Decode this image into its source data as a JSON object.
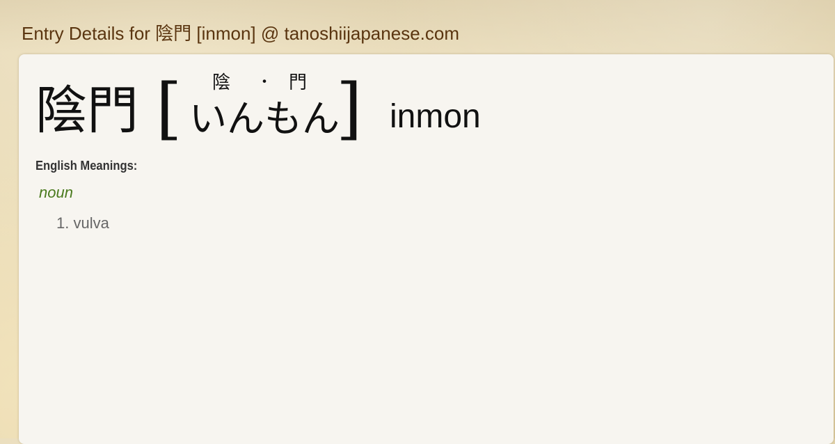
{
  "page": {
    "title": "Entry Details for 陰門 [inmon] @ tanoshiijapanese.com"
  },
  "entry": {
    "kanji": "陰門",
    "bracket_open": "[",
    "bracket_close": "]",
    "furigana": {
      "kanji_1": "陰",
      "separator": "・",
      "kanji_2": "門"
    },
    "kana": "いんもん",
    "romaji": "inmon"
  },
  "meanings": {
    "heading": "English Meanings:",
    "part_of_speech": "noun",
    "definitions": [
      "1. vulva"
    ]
  },
  "colors": {
    "title": "#5a3510",
    "pos": "#4a7a1e",
    "definition": "#666666",
    "card": "#f7f5f0"
  }
}
